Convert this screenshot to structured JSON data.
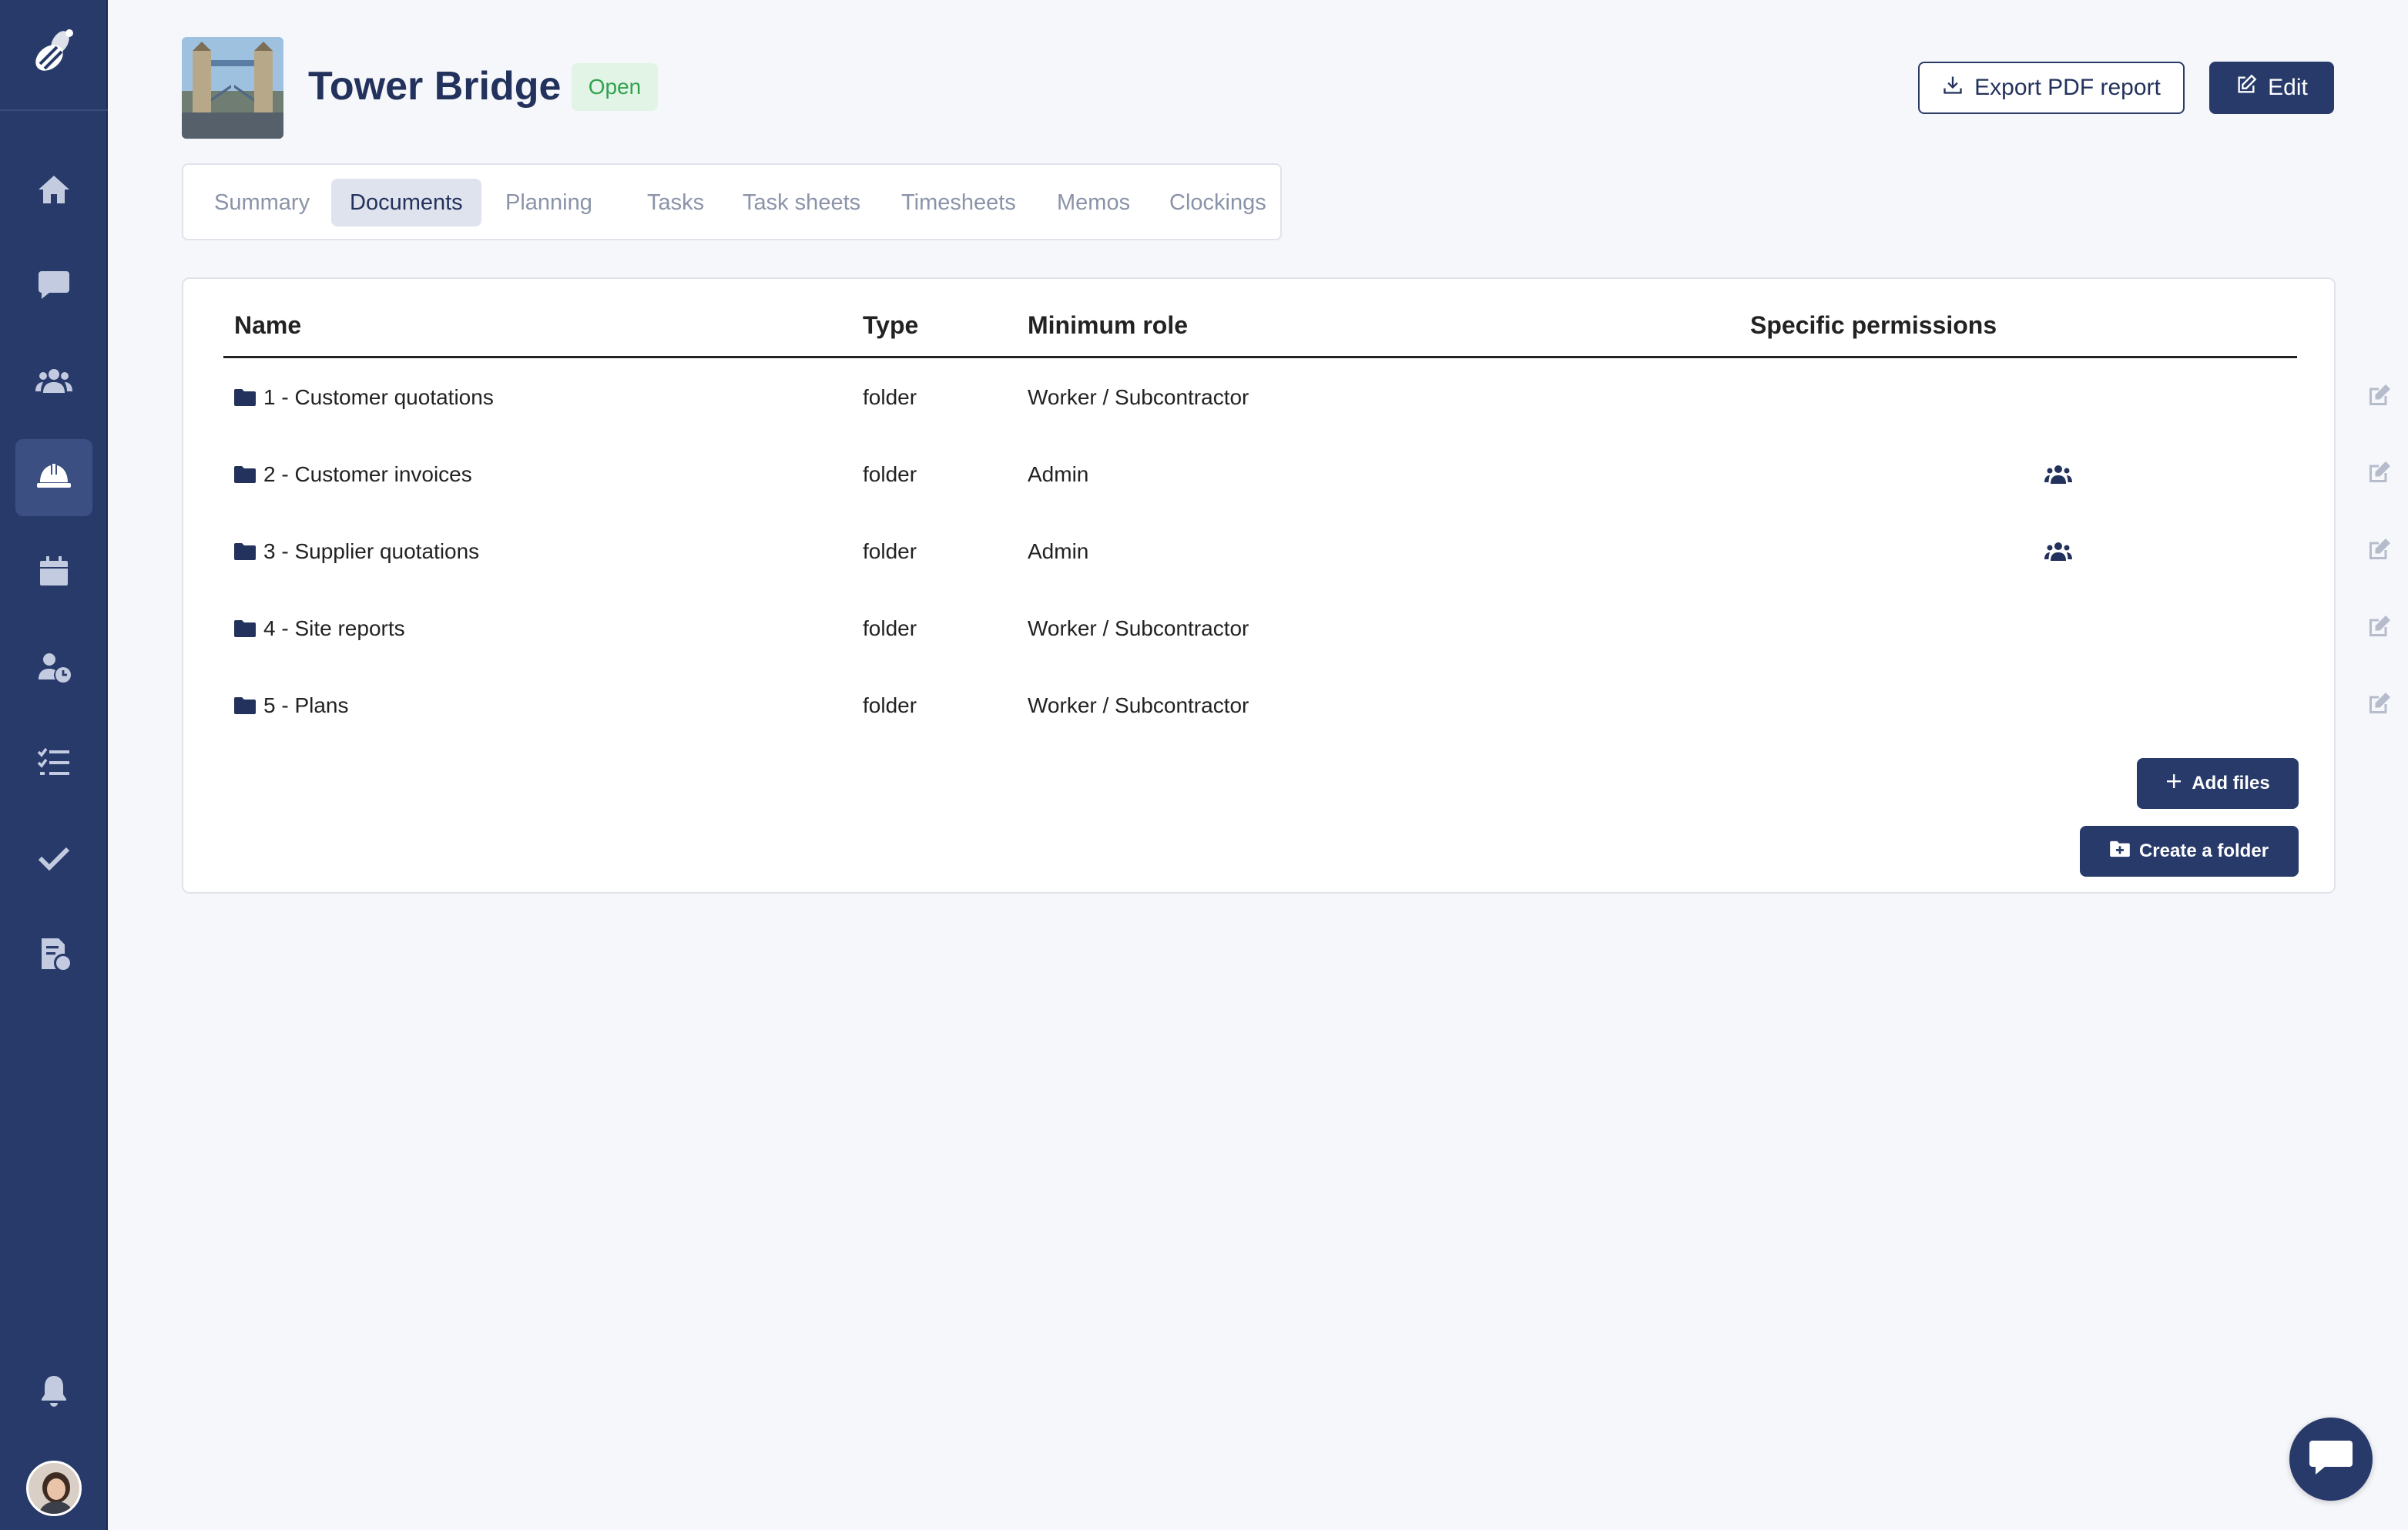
{
  "sidebar": {
    "logo_icon": "bee-logo-icon",
    "items": [
      {
        "icon": "home-icon",
        "active": false
      },
      {
        "icon": "chat-icon",
        "active": false
      },
      {
        "icon": "users-icon",
        "active": false
      },
      {
        "icon": "hard-hat-icon",
        "active": true
      },
      {
        "icon": "calendar-icon",
        "active": false
      },
      {
        "icon": "user-clock-icon",
        "active": false
      },
      {
        "icon": "task-list-icon",
        "active": false
      },
      {
        "icon": "check-icon",
        "active": false
      },
      {
        "icon": "invoice-icon",
        "active": false
      }
    ],
    "bell_icon": "bell-icon",
    "avatar": "user-avatar"
  },
  "header": {
    "title": "Tower Bridge",
    "status": "Open",
    "export_label": "Export PDF report",
    "edit_label": "Edit"
  },
  "tabs": [
    {
      "label": "Summary",
      "active": false
    },
    {
      "label": "Documents",
      "active": true
    },
    {
      "label": "Planning",
      "active": false
    },
    {
      "label": "Tasks",
      "active": false
    },
    {
      "label": "Task sheets",
      "active": false
    },
    {
      "label": "Timesheets",
      "active": false
    },
    {
      "label": "Memos",
      "active": false
    },
    {
      "label": "Clockings",
      "active": false
    }
  ],
  "table": {
    "columns": {
      "name": "Name",
      "type": "Type",
      "min_role": "Minimum role",
      "permissions": "Specific permissions"
    },
    "rows": [
      {
        "name": "1 - Customer quotations",
        "type": "folder",
        "role": "Worker / Subcontractor",
        "specific": false
      },
      {
        "name": "2 - Customer invoices",
        "type": "folder",
        "role": "Admin",
        "specific": true
      },
      {
        "name": "3 - Supplier quotations",
        "type": "folder",
        "role": "Admin",
        "specific": true
      },
      {
        "name": "4 - Site reports",
        "type": "folder",
        "role": "Worker / Subcontractor",
        "specific": false
      },
      {
        "name": "5 - Plans",
        "type": "folder",
        "role": "Worker / Subcontractor",
        "specific": false
      }
    ]
  },
  "actions": {
    "add_files": "Add files",
    "create_folder": "Create a folder"
  },
  "colors": {
    "sidebar": "#273a6a",
    "accent": "#273a6a",
    "status_bg": "#e2f4e6",
    "status_text": "#2fa24d"
  }
}
